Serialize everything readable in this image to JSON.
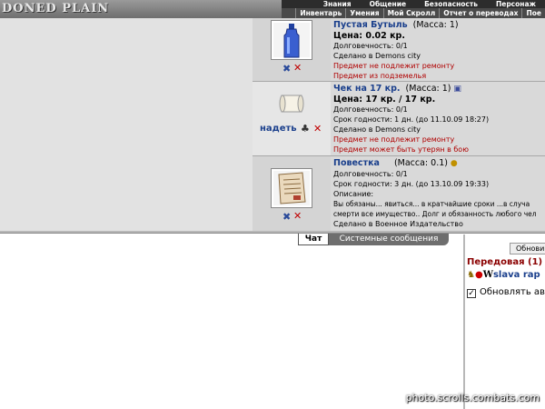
{
  "header": {
    "logo_text": "DONED PLAIN",
    "top_menu": [
      "Знания",
      "Общение",
      "Безопасность",
      "Персонаж"
    ],
    "sub_menu": [
      "Инвентарь",
      "Умения",
      "Мой Скролл",
      "Отчет о переводах",
      "Пое"
    ]
  },
  "items": [
    {
      "name": "Пустая Бутыль",
      "mass": "(Масса: 1)",
      "price": "Цена: 0.02 кр.",
      "durability": "Долговечность: 0/1",
      "made_in": "Сделано в Demons city",
      "note1": "Предмет не подлежит ремонту",
      "note2": "Предмет из подземелья"
    },
    {
      "name": "Чек на 17 кр.",
      "mass": "(Масса: 1)",
      "price": "Цена: 17 кр. / 17 кр.",
      "durability": "Долговечность: 0/1",
      "expiry": "Срок годности: 1 дн. (до 11.10.09 18:27)",
      "made_in": "Сделано в Demons city",
      "note1": "Предмет не подлежит ремонту",
      "note2": "Предмет может быть утерян в бою",
      "wear_label": "надеть"
    },
    {
      "name": "Повестка",
      "mass": "(Масса: 0.1)",
      "durability": "Долговечность: 0/1",
      "expiry": "Срок годности: 3 дн. (до 13.10.09 19:33)",
      "desc_label": "Описание:",
      "desc_line1": "Вы обязаны... явиться... в кратчайшие сроки ...в случа",
      "desc_line2": "смерти все имущество.. Долг и обязанность любого чел",
      "made_in": "Сделано в Военное Издательство"
    }
  ],
  "chat": {
    "tab_chat": "Чат",
    "tab_system": "Системные сообщения"
  },
  "right_panel": {
    "refresh_button": "Обнови",
    "room_title": "Передовая (1)",
    "user_name": "slava rap",
    "auto_refresh": "Обновлять авт"
  },
  "watermark": "photo.scrolls.combats.com"
}
